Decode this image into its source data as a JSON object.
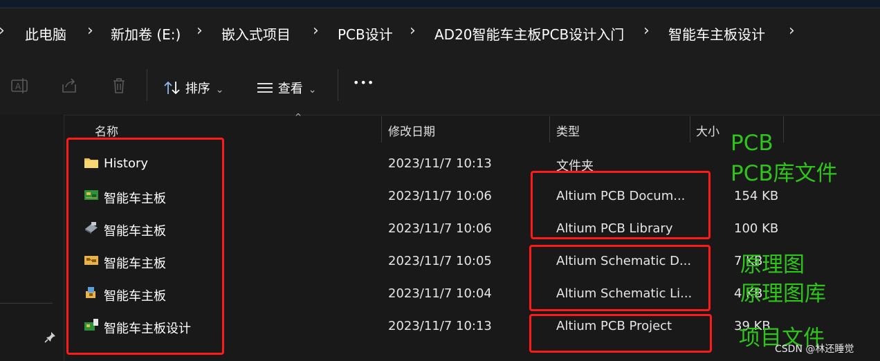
{
  "breadcrumb": [
    "此电脑",
    "新加卷 (E:)",
    "嵌入式项目",
    "PCB设计",
    "AD20智能车主板PCB设计入门",
    "智能车主板设计"
  ],
  "toolbar": {
    "sort_label": "排序",
    "view_label": "查看",
    "more_label": "•••"
  },
  "columns": {
    "name": "名称",
    "modified": "修改日期",
    "type": "类型",
    "size": "大小"
  },
  "files": [
    {
      "name": "History",
      "date": "2023/11/7 10:13",
      "type": "文件夹",
      "size": "",
      "icon": "folder-icon"
    },
    {
      "name": "智能车主板",
      "date": "2023/11/7 10:06",
      "type": "Altium PCB Docum...",
      "size": "154 KB",
      "icon": "pcb-document-icon"
    },
    {
      "name": "智能车主板",
      "date": "2023/11/7 10:06",
      "type": "Altium PCB Library",
      "size": "100 KB",
      "icon": "pcb-library-icon"
    },
    {
      "name": "智能车主板",
      "date": "2023/11/7 10:05",
      "type": "Altium Schematic D...",
      "size": "7 KB",
      "icon": "schematic-document-icon"
    },
    {
      "name": "智能车主板",
      "date": "2023/11/7 10:04",
      "type": "Altium Schematic Li...",
      "size": "4 KB",
      "icon": "schematic-library-icon"
    },
    {
      "name": "智能车主板设计",
      "date": "2023/11/7 10:13",
      "type": "Altium PCB Project",
      "size": "39 KB",
      "icon": "pcb-project-icon"
    }
  ],
  "annotations": {
    "pcb": "PCB",
    "pcb_lib": "PCB库文件",
    "schematic": "原理图",
    "schematic_lib": "原理图库",
    "project": "项目文件"
  },
  "watermark": "CSDN @林还睡觉",
  "colors": {
    "annotation_green": "#2fc41a",
    "highlight_red": "#ff1a1a",
    "background": "#191919"
  }
}
